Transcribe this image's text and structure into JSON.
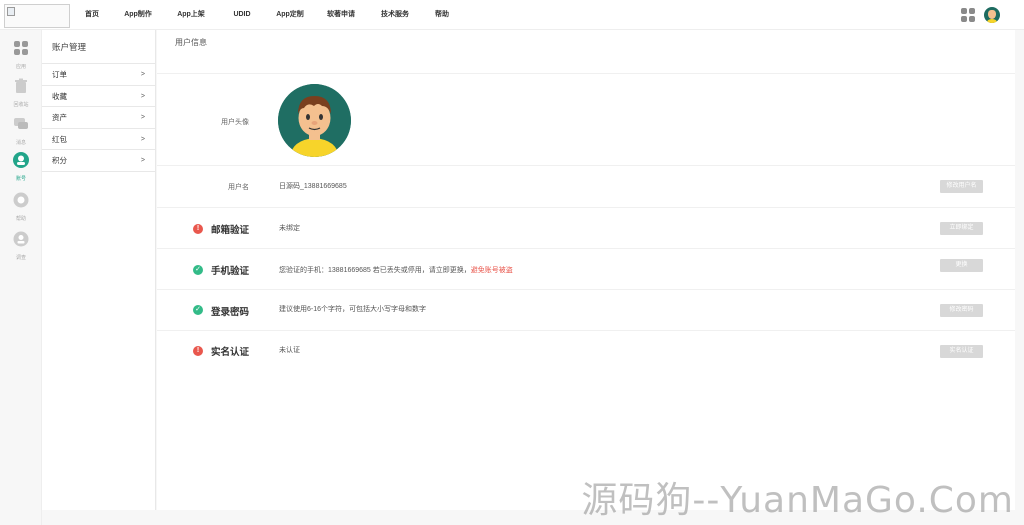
{
  "nav": {
    "items": [
      "首页",
      "App制作",
      "App上架",
      "UDID",
      "App定制",
      "软著申请",
      "技术服务",
      "帮助"
    ]
  },
  "rail": {
    "items": [
      {
        "label": "应用",
        "icon": "apps-icon"
      },
      {
        "label": "回收站",
        "icon": "trash-icon"
      },
      {
        "label": "消息",
        "icon": "message-icon"
      },
      {
        "label": "账号",
        "icon": "account-icon"
      },
      {
        "label": "帮助",
        "icon": "help-icon"
      },
      {
        "label": "调查",
        "icon": "survey-icon"
      }
    ]
  },
  "submenu": {
    "title": "账户管理",
    "items": [
      {
        "label": "订单",
        "arrow": ">"
      },
      {
        "label": "收藏",
        "arrow": ">"
      },
      {
        "label": "资产",
        "arrow": ">"
      },
      {
        "label": "红包",
        "arrow": ">"
      },
      {
        "label": "积分",
        "arrow": ">"
      }
    ]
  },
  "main": {
    "title": "用户信息",
    "avatar_label": "用户头像",
    "username": {
      "label": "用户名",
      "value": "日源码_13881669685",
      "button": "修改用户名"
    },
    "email": {
      "label": "邮箱验证",
      "value": "未绑定",
      "button": "立即绑定",
      "status": "error"
    },
    "phone": {
      "label": "手机验证",
      "value": "您验证的手机：13881669685 若已丢失或停用，请立即更换，",
      "warn": "避免账号被盗",
      "button": "更换",
      "status": "ok"
    },
    "password": {
      "label": "登录密码",
      "value": "建议使用6-16个字符，可包括大小写字母和数字",
      "button": "修改密码",
      "status": "ok"
    },
    "realname": {
      "label": "实名认证",
      "value": "未认证",
      "button": "实名认证",
      "status": "error"
    }
  },
  "colors": {
    "accent": "#22a58a",
    "error": "#e9574d",
    "ok": "#33bb88",
    "button": "#d8d8d8"
  },
  "watermark": "源码狗--YuanMaGo.Com"
}
